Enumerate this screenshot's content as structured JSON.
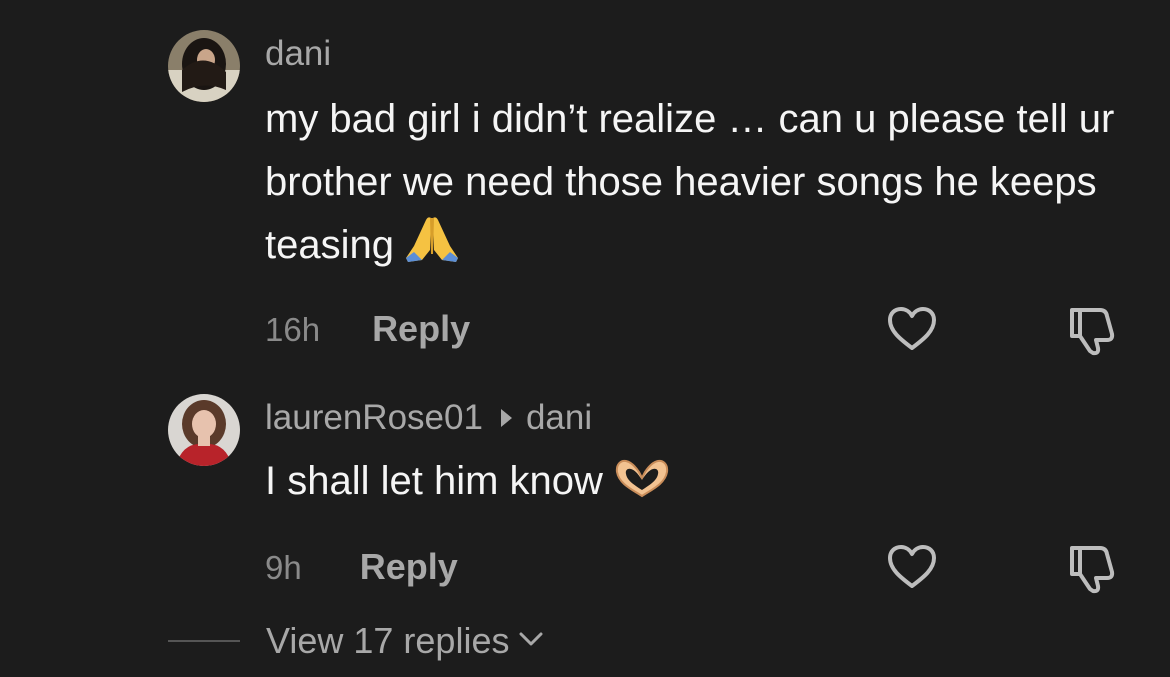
{
  "comments": [
    {
      "username": "dani",
      "text": "my bad girl i didn’t realize … can u please tell ur brother we need those heavier songs he keeps teasing",
      "emoji": "🙏",
      "time": "16h",
      "reply_label": "Reply"
    },
    {
      "username": "laurenRose01",
      "reply_to": "dani",
      "text": "I shall let him know",
      "emoji": "🫶",
      "time": "9h",
      "reply_label": "Reply"
    }
  ],
  "view_replies": "View 17 replies"
}
